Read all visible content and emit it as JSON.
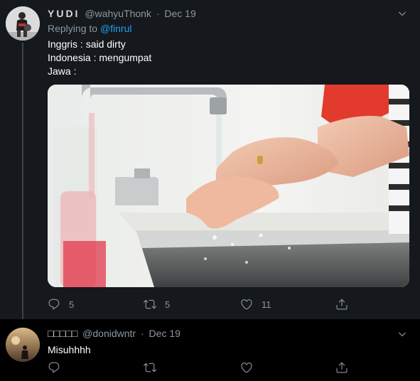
{
  "tweet1": {
    "name": "YUDI",
    "handle": "@wahyuThonk",
    "separator": "·",
    "date": "Dec 19",
    "replying_prefix": "Replying to",
    "replying_to": "@finrul",
    "lines": [
      "Inggris : said dirty",
      "Indonesia : mengumpat",
      "Jawa :"
    ],
    "replies": "5",
    "retweets": "5",
    "likes": "11"
  },
  "tweet2": {
    "name": "□□□□□",
    "handle": "@donidwntr",
    "separator": "·",
    "date": "Dec 19",
    "text": "Misuhhhh"
  },
  "icons": {
    "more": "chevron-down-icon",
    "reply": "reply-icon",
    "retweet": "retweet-icon",
    "like": "heart-icon",
    "share": "share-icon"
  },
  "colors": {
    "background": "#15181c",
    "background_reply": "#000000",
    "text": "#ffffff",
    "secondary": "#8b98a5",
    "link": "#1da1f2"
  }
}
